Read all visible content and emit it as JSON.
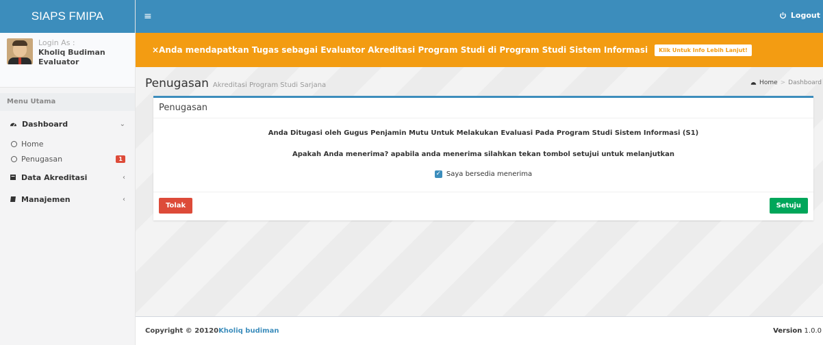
{
  "app": {
    "title": "SIAPS FMIPA"
  },
  "user": {
    "login_as_label": "Login As :",
    "name": "Kholiq Budiman",
    "role": "Evaluator"
  },
  "sidebar": {
    "menu_header": "Menu Utama",
    "dashboard": {
      "label": "Dashboard",
      "icon": "dashboard-icon"
    },
    "sub_items": [
      {
        "label": "Home"
      },
      {
        "label": "Penugasan",
        "badge": "1"
      }
    ],
    "data_akreditasi": {
      "label": "Data Akreditasi",
      "icon": "book-icon"
    },
    "manajemen": {
      "label": "Manajemen",
      "icon": "book-icon"
    }
  },
  "header": {
    "logout_label": "Logout"
  },
  "notice": {
    "text": "×Anda mendapatkan Tugas sebagai Evaluator Akreditasi Program Studi di Program Studi Sistem Informasi",
    "button_label": "Klik Untuk Info Lebih Lanjut!"
  },
  "content": {
    "title": "Penugasan",
    "subtitle": "Akreditasi Program Studi Sarjana",
    "breadcrumb": {
      "home": "Home",
      "separator": ">",
      "current": "Dashboard"
    }
  },
  "box": {
    "title": "Penugasan",
    "line1": "Anda Ditugasi oleh Gugus Penjamin Mutu Untuk Melakukan Evaluasi Pada Program Studi Sistem Informasi (S1)",
    "line2": "Apakah Anda menerima? apabila anda menerima silahkan tekan tombol setujui untuk melanjutkan",
    "checkbox_label": "Saya bersedia menerima",
    "checkbox_checked": true,
    "reject_label": "Tolak",
    "accept_label": "Setuju"
  },
  "footer": {
    "copyright": "Copyright © 20120",
    "author": "Kholiq budiman",
    "version_label": "Version",
    "version_value": "1.0.0"
  },
  "colors": {
    "primary": "#3c8dbc",
    "warning": "#f39c12",
    "danger": "#dd4b39",
    "success": "#00a65a"
  }
}
